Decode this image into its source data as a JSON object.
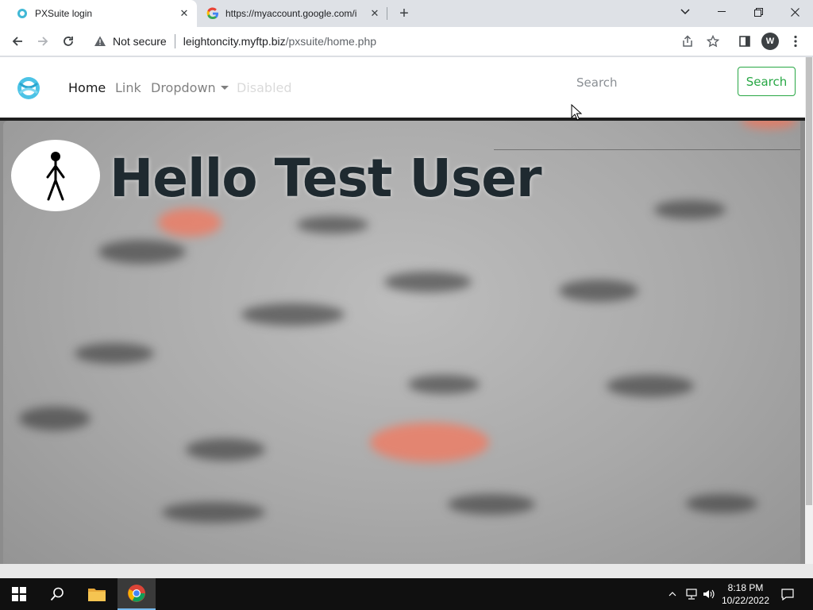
{
  "browser": {
    "tabs": [
      {
        "title": "PXSuite login",
        "active": true
      },
      {
        "title": "https://myaccount.google.com/i",
        "active": false
      }
    ],
    "new_tab_symbol": "+",
    "address": {
      "security_label": "Not secure",
      "host": "leightoncity.myftp.biz",
      "path": "/pxsuite/home.php"
    },
    "profile_initial": "W"
  },
  "page": {
    "nav": {
      "links": [
        "Home",
        "Link",
        "Dropdown",
        "Disabled"
      ]
    },
    "search": {
      "placeholder": "Search",
      "button_label": "Search"
    },
    "hero": {
      "title": "Hello Test User"
    }
  },
  "taskbar": {
    "time": "8:18 PM",
    "date": "10/22/2022"
  },
  "colors": {
    "accent_green": "#28a745",
    "taskbar_bg": "#101010"
  }
}
